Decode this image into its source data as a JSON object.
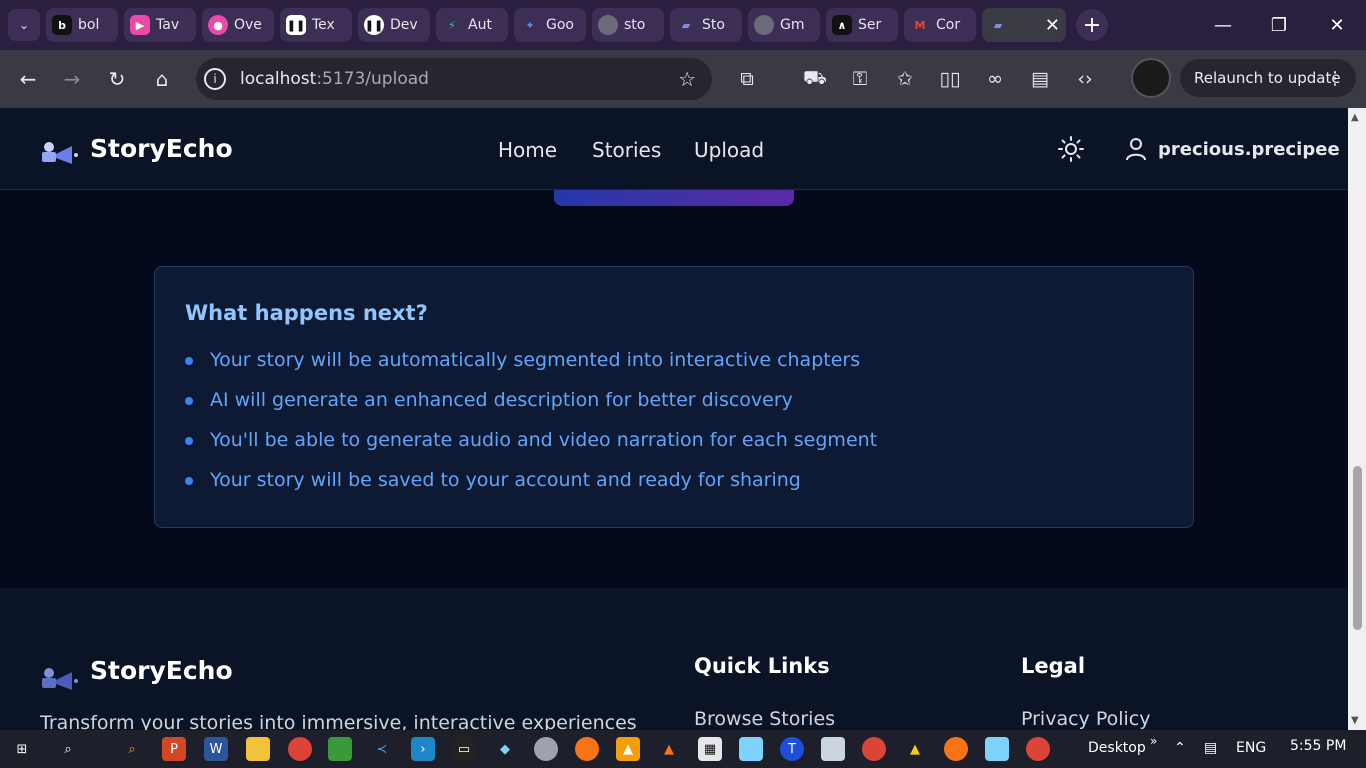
{
  "browser": {
    "tabs": [
      {
        "label": "bol",
        "icon": "bolt-icon",
        "color": "#111111"
      },
      {
        "label": "Tav",
        "icon": "tavus-icon",
        "color": "#e94aa8"
      },
      {
        "label": "Ove",
        "icon": "overview-icon",
        "color": "#e94aa8"
      },
      {
        "label": "Tex",
        "icon": "pause-icon",
        "color": "#ffffff"
      },
      {
        "label": "Dev",
        "icon": "devpost-icon",
        "color": "#1a1a1a"
      },
      {
        "label": "Aut",
        "icon": "supabase-icon",
        "color": "#3ecf8e"
      },
      {
        "label": "Goo",
        "icon": "gemini-icon",
        "color": "#4f8ef7"
      },
      {
        "label": "sto",
        "icon": "globe-icon",
        "color": "#6b6b7a"
      },
      {
        "label": "Sto",
        "icon": "storyecho-icon",
        "color": "#3c2e55"
      },
      {
        "label": "Gm",
        "icon": "globe-icon",
        "color": "#6b6b7a"
      },
      {
        "label": "Ser",
        "icon": "serp-icon",
        "color": "#111111"
      },
      {
        "label": "Cor",
        "icon": "gmail-icon",
        "color": "#ea4335"
      }
    ],
    "active_tab_close": "✕",
    "new_tab": "+",
    "url_host": "localhost",
    "url_path": ":5173/upload",
    "relaunch_label": "Relaunch to update"
  },
  "site": {
    "brand": "StoryEcho",
    "nav": [
      "Home",
      "Stories",
      "Upload"
    ],
    "username": "precious.precipee"
  },
  "next": {
    "title": "What happens next?",
    "items": [
      "Your story will be automatically segmented into interactive chapters",
      "AI will generate an enhanced description for better discovery",
      "You'll be able to generate audio and video narration for each segment",
      "Your story will be saved to your account and ready for sharing"
    ]
  },
  "footer": {
    "brand": "StoryEcho",
    "tagline": "Transform your stories into immersive, interactive experiences",
    "quick_links_title": "Quick Links",
    "quick_links": [
      "Browse Stories"
    ],
    "legal_title": "Legal",
    "legal_links": [
      "Privacy Policy"
    ]
  },
  "taskbar": {
    "desktop_label": "Desktop",
    "language": "ENG",
    "time": "5:55 PM"
  },
  "colors": {
    "accent": "#60a5fa",
    "heading_accent": "#93c5fd",
    "page_bg": "#040a1c"
  }
}
